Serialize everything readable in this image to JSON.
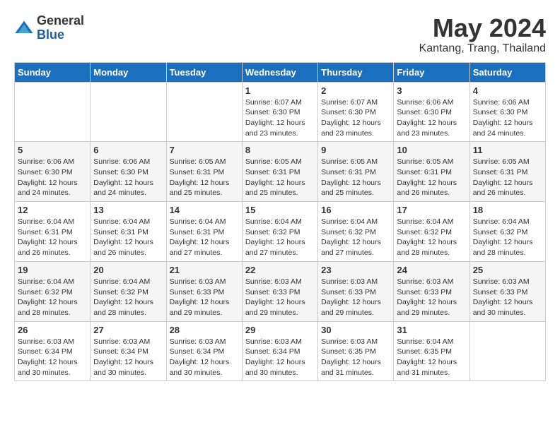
{
  "header": {
    "logo_general": "General",
    "logo_blue": "Blue",
    "title": "May 2024",
    "subtitle": "Kantang, Trang, Thailand"
  },
  "weekdays": [
    "Sunday",
    "Monday",
    "Tuesday",
    "Wednesday",
    "Thursday",
    "Friday",
    "Saturday"
  ],
  "weeks": [
    [
      {
        "day": "",
        "info": ""
      },
      {
        "day": "",
        "info": ""
      },
      {
        "day": "",
        "info": ""
      },
      {
        "day": "1",
        "info": "Sunrise: 6:07 AM\nSunset: 6:30 PM\nDaylight: 12 hours\nand 23 minutes."
      },
      {
        "day": "2",
        "info": "Sunrise: 6:07 AM\nSunset: 6:30 PM\nDaylight: 12 hours\nand 23 minutes."
      },
      {
        "day": "3",
        "info": "Sunrise: 6:06 AM\nSunset: 6:30 PM\nDaylight: 12 hours\nand 23 minutes."
      },
      {
        "day": "4",
        "info": "Sunrise: 6:06 AM\nSunset: 6:30 PM\nDaylight: 12 hours\nand 24 minutes."
      }
    ],
    [
      {
        "day": "5",
        "info": "Sunrise: 6:06 AM\nSunset: 6:30 PM\nDaylight: 12 hours\nand 24 minutes."
      },
      {
        "day": "6",
        "info": "Sunrise: 6:06 AM\nSunset: 6:30 PM\nDaylight: 12 hours\nand 24 minutes."
      },
      {
        "day": "7",
        "info": "Sunrise: 6:05 AM\nSunset: 6:31 PM\nDaylight: 12 hours\nand 25 minutes."
      },
      {
        "day": "8",
        "info": "Sunrise: 6:05 AM\nSunset: 6:31 PM\nDaylight: 12 hours\nand 25 minutes."
      },
      {
        "day": "9",
        "info": "Sunrise: 6:05 AM\nSunset: 6:31 PM\nDaylight: 12 hours\nand 25 minutes."
      },
      {
        "day": "10",
        "info": "Sunrise: 6:05 AM\nSunset: 6:31 PM\nDaylight: 12 hours\nand 26 minutes."
      },
      {
        "day": "11",
        "info": "Sunrise: 6:05 AM\nSunset: 6:31 PM\nDaylight: 12 hours\nand 26 minutes."
      }
    ],
    [
      {
        "day": "12",
        "info": "Sunrise: 6:04 AM\nSunset: 6:31 PM\nDaylight: 12 hours\nand 26 minutes."
      },
      {
        "day": "13",
        "info": "Sunrise: 6:04 AM\nSunset: 6:31 PM\nDaylight: 12 hours\nand 26 minutes."
      },
      {
        "day": "14",
        "info": "Sunrise: 6:04 AM\nSunset: 6:31 PM\nDaylight: 12 hours\nand 27 minutes."
      },
      {
        "day": "15",
        "info": "Sunrise: 6:04 AM\nSunset: 6:32 PM\nDaylight: 12 hours\nand 27 minutes."
      },
      {
        "day": "16",
        "info": "Sunrise: 6:04 AM\nSunset: 6:32 PM\nDaylight: 12 hours\nand 27 minutes."
      },
      {
        "day": "17",
        "info": "Sunrise: 6:04 AM\nSunset: 6:32 PM\nDaylight: 12 hours\nand 28 minutes."
      },
      {
        "day": "18",
        "info": "Sunrise: 6:04 AM\nSunset: 6:32 PM\nDaylight: 12 hours\nand 28 minutes."
      }
    ],
    [
      {
        "day": "19",
        "info": "Sunrise: 6:04 AM\nSunset: 6:32 PM\nDaylight: 12 hours\nand 28 minutes."
      },
      {
        "day": "20",
        "info": "Sunrise: 6:04 AM\nSunset: 6:32 PM\nDaylight: 12 hours\nand 28 minutes."
      },
      {
        "day": "21",
        "info": "Sunrise: 6:03 AM\nSunset: 6:33 PM\nDaylight: 12 hours\nand 29 minutes."
      },
      {
        "day": "22",
        "info": "Sunrise: 6:03 AM\nSunset: 6:33 PM\nDaylight: 12 hours\nand 29 minutes."
      },
      {
        "day": "23",
        "info": "Sunrise: 6:03 AM\nSunset: 6:33 PM\nDaylight: 12 hours\nand 29 minutes."
      },
      {
        "day": "24",
        "info": "Sunrise: 6:03 AM\nSunset: 6:33 PM\nDaylight: 12 hours\nand 29 minutes."
      },
      {
        "day": "25",
        "info": "Sunrise: 6:03 AM\nSunset: 6:33 PM\nDaylight: 12 hours\nand 30 minutes."
      }
    ],
    [
      {
        "day": "26",
        "info": "Sunrise: 6:03 AM\nSunset: 6:34 PM\nDaylight: 12 hours\nand 30 minutes."
      },
      {
        "day": "27",
        "info": "Sunrise: 6:03 AM\nSunset: 6:34 PM\nDaylight: 12 hours\nand 30 minutes."
      },
      {
        "day": "28",
        "info": "Sunrise: 6:03 AM\nSunset: 6:34 PM\nDaylight: 12 hours\nand 30 minutes."
      },
      {
        "day": "29",
        "info": "Sunrise: 6:03 AM\nSunset: 6:34 PM\nDaylight: 12 hours\nand 30 minutes."
      },
      {
        "day": "30",
        "info": "Sunrise: 6:03 AM\nSunset: 6:35 PM\nDaylight: 12 hours\nand 31 minutes."
      },
      {
        "day": "31",
        "info": "Sunrise: 6:04 AM\nSunset: 6:35 PM\nDaylight: 12 hours\nand 31 minutes."
      },
      {
        "day": "",
        "info": ""
      }
    ]
  ]
}
